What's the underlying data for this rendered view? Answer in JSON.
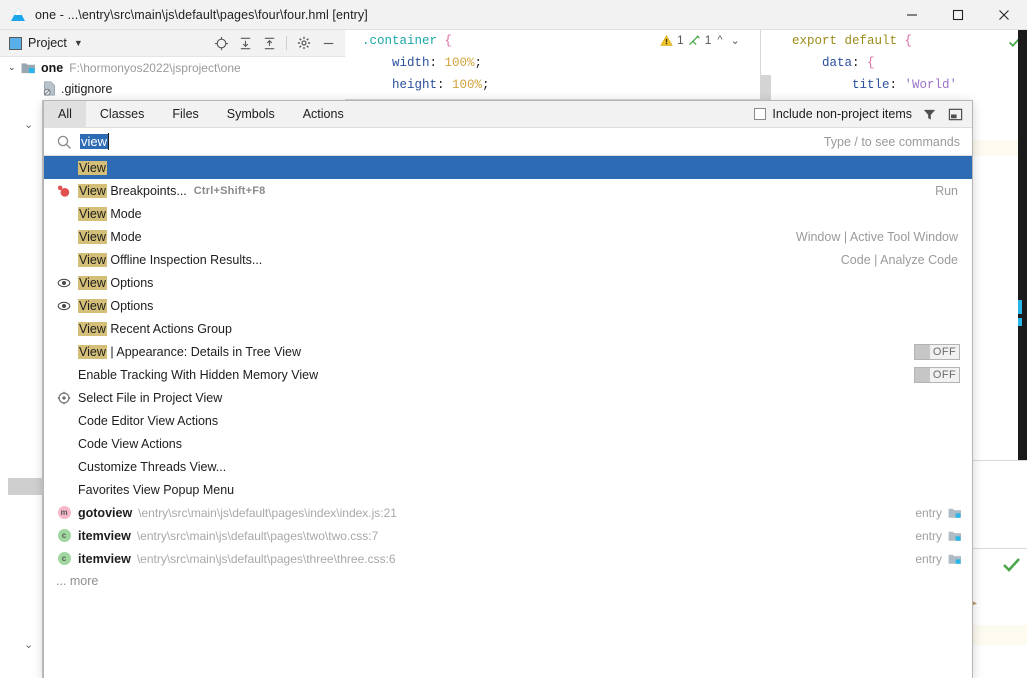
{
  "window": {
    "title": "one - ...\\entry\\src\\main\\js\\default\\pages\\four\\four.hml [entry]",
    "logo_icon": "idea-logo-icon",
    "minimize_label": "minimize-icon",
    "maximize_label": "maximize-icon",
    "close_label": "close-icon"
  },
  "project_panel": {
    "label": "Project",
    "caret_icon": "chevron-down-icon",
    "tools": [
      {
        "name": "locate-file-icon"
      },
      {
        "name": "expand-all-icon"
      },
      {
        "name": "collapse-all-icon"
      },
      {
        "name": "settings-gear-icon"
      },
      {
        "name": "hide-panel-icon"
      }
    ],
    "tree": [
      {
        "arrow": "⌄",
        "icon": "module-folder-icon",
        "name": "one",
        "path": "F:\\hormonyos2022\\jsproject\\one",
        "bold": true
      },
      {
        "arrow": "",
        "icon": "gitignore-file-icon",
        "name": ".gitignore",
        "path": "",
        "bold": false
      }
    ]
  },
  "editor": {
    "css_lines": [
      {
        "parts": [
          {
            "t": ".container ",
            "c": "c-sel"
          },
          {
            "t": "{",
            "c": "c-brace"
          }
        ]
      },
      {
        "parts": [
          {
            "t": "    width",
            "c": "c-prop"
          },
          {
            "t": ": ",
            "c": "c-punct"
          },
          {
            "t": "100%",
            "c": "c-val"
          },
          {
            "t": ";",
            "c": "c-punct"
          }
        ]
      },
      {
        "parts": [
          {
            "t": "    height",
            "c": "c-prop"
          },
          {
            "t": ": ",
            "c": "c-punct"
          },
          {
            "t": "100%",
            "c": "c-val"
          },
          {
            "t": ";",
            "c": "c-punct"
          }
        ]
      }
    ],
    "js_lines": [
      {
        "parts": [
          {
            "t": "export default ",
            "c": "c-kw"
          },
          {
            "t": "{",
            "c": "c-brace"
          }
        ]
      },
      {
        "parts": [
          {
            "t": "    data",
            "c": "c-prop"
          },
          {
            "t": ": ",
            "c": "c-punct"
          },
          {
            "t": "{",
            "c": "c-brace"
          }
        ]
      },
      {
        "parts": [
          {
            "t": "        title",
            "c": "c-prop"
          },
          {
            "t": ": ",
            "c": "c-punct"
          },
          {
            "t": "'World'",
            "c": "c-str"
          }
        ]
      }
    ],
    "inspection": {
      "warning_icon": "warning-triangle-icon",
      "warning_count": "1",
      "weak_warning_icon": "weak-warning-icon",
      "weak_warning_count": "1",
      "prev_icon": "chevron-up-icon",
      "next_icon": "chevron-down-icon",
      "ok_icon": "inspection-ok-checkmark-icon"
    }
  },
  "popup": {
    "tabs": [
      {
        "label": "All",
        "active": true
      },
      {
        "label": "Classes",
        "active": false
      },
      {
        "label": "Files",
        "active": false
      },
      {
        "label": "Symbols",
        "active": false
      },
      {
        "label": "Actions",
        "active": false
      }
    ],
    "include_non_project": {
      "label": "Include non-project items",
      "checked": false
    },
    "filter_icon": "filter-funnel-icon",
    "pin_icon": "pin-window-icon",
    "search": {
      "icon": "search-icon",
      "value": "view",
      "hint": "Type / to see commands"
    },
    "more_label": "... more",
    "rows": [
      {
        "icon": "",
        "match": "View",
        "label": "",
        "shortcut": "",
        "right": "",
        "selected": true
      },
      {
        "icon": "breakpoint-icon",
        "match": "View",
        "label": " Breakpoints...",
        "shortcut": "Ctrl+Shift+F8",
        "right": "Run",
        "selected": false
      },
      {
        "icon": "",
        "match": "View",
        "label": " Mode",
        "shortcut": "",
        "right": "",
        "selected": false
      },
      {
        "icon": "",
        "match": "View",
        "label": " Mode",
        "shortcut": "",
        "right": "Window | Active Tool Window",
        "selected": false
      },
      {
        "icon": "",
        "match": "View",
        "label": " Offline Inspection Results...",
        "shortcut": "",
        "right": "Code | Analyze Code",
        "selected": false
      },
      {
        "icon": "eye-icon",
        "match": "View",
        "label": " Options",
        "shortcut": "",
        "right": "",
        "selected": false
      },
      {
        "icon": "eye-icon",
        "match": "View",
        "label": " Options",
        "shortcut": "",
        "right": "",
        "selected": false
      },
      {
        "icon": "",
        "match": "View",
        "label": " Recent Actions Group",
        "shortcut": "",
        "right": "",
        "selected": false
      },
      {
        "icon": "",
        "match": "View",
        "label": " | Appearance: Details in Tree View",
        "shortcut": "",
        "right": "",
        "toggle": "OFF",
        "selected": false
      },
      {
        "icon": "",
        "match": "",
        "label": "Enable Tracking With Hidden Memory View",
        "shortcut": "",
        "right": "",
        "toggle": "OFF",
        "selected": false
      },
      {
        "icon": "target-icon",
        "match": "",
        "label": "Select File in Project View",
        "shortcut": "",
        "right": "",
        "selected": false
      },
      {
        "icon": "",
        "match": "",
        "label": "Code Editor View Actions",
        "shortcut": "",
        "right": "",
        "selected": false
      },
      {
        "icon": "",
        "match": "",
        "label": "Code View Actions",
        "shortcut": "",
        "right": "",
        "selected": false
      },
      {
        "icon": "",
        "match": "",
        "label": "Customize Threads View...",
        "shortcut": "",
        "right": "",
        "selected": false
      },
      {
        "icon": "",
        "match": "",
        "label": "Favorites View Popup Menu",
        "shortcut": "",
        "right": "",
        "selected": false
      }
    ],
    "file_rows": [
      {
        "badge": "m",
        "name": "gotoview",
        "path": "\\entry\\src\\main\\js\\default\\pages\\index\\index.js:21",
        "module": "entry",
        "module_icon": "module-folder-icon"
      },
      {
        "badge": "c",
        "name": "itemview",
        "path": "\\entry\\src\\main\\js\\default\\pages\\two\\two.css:7",
        "module": "entry",
        "module_icon": "module-folder-icon"
      },
      {
        "badge": "c",
        "name": "itemview",
        "path": "\\entry\\src\\main\\js\\default\\pages\\three\\three.css:6",
        "module": "entry",
        "module_icon": "module-folder-icon"
      }
    ]
  },
  "gutter": {
    "top_chevron_icon": "chevron-down-icon",
    "bottom_chevron_icon": "chevron-down-icon"
  },
  "colors": {
    "selection_blue": "#2d6cb5",
    "match_highlight": "#d4bf79",
    "accent_cyan": "#29b6e8",
    "ok_green": "#4aa84a"
  }
}
